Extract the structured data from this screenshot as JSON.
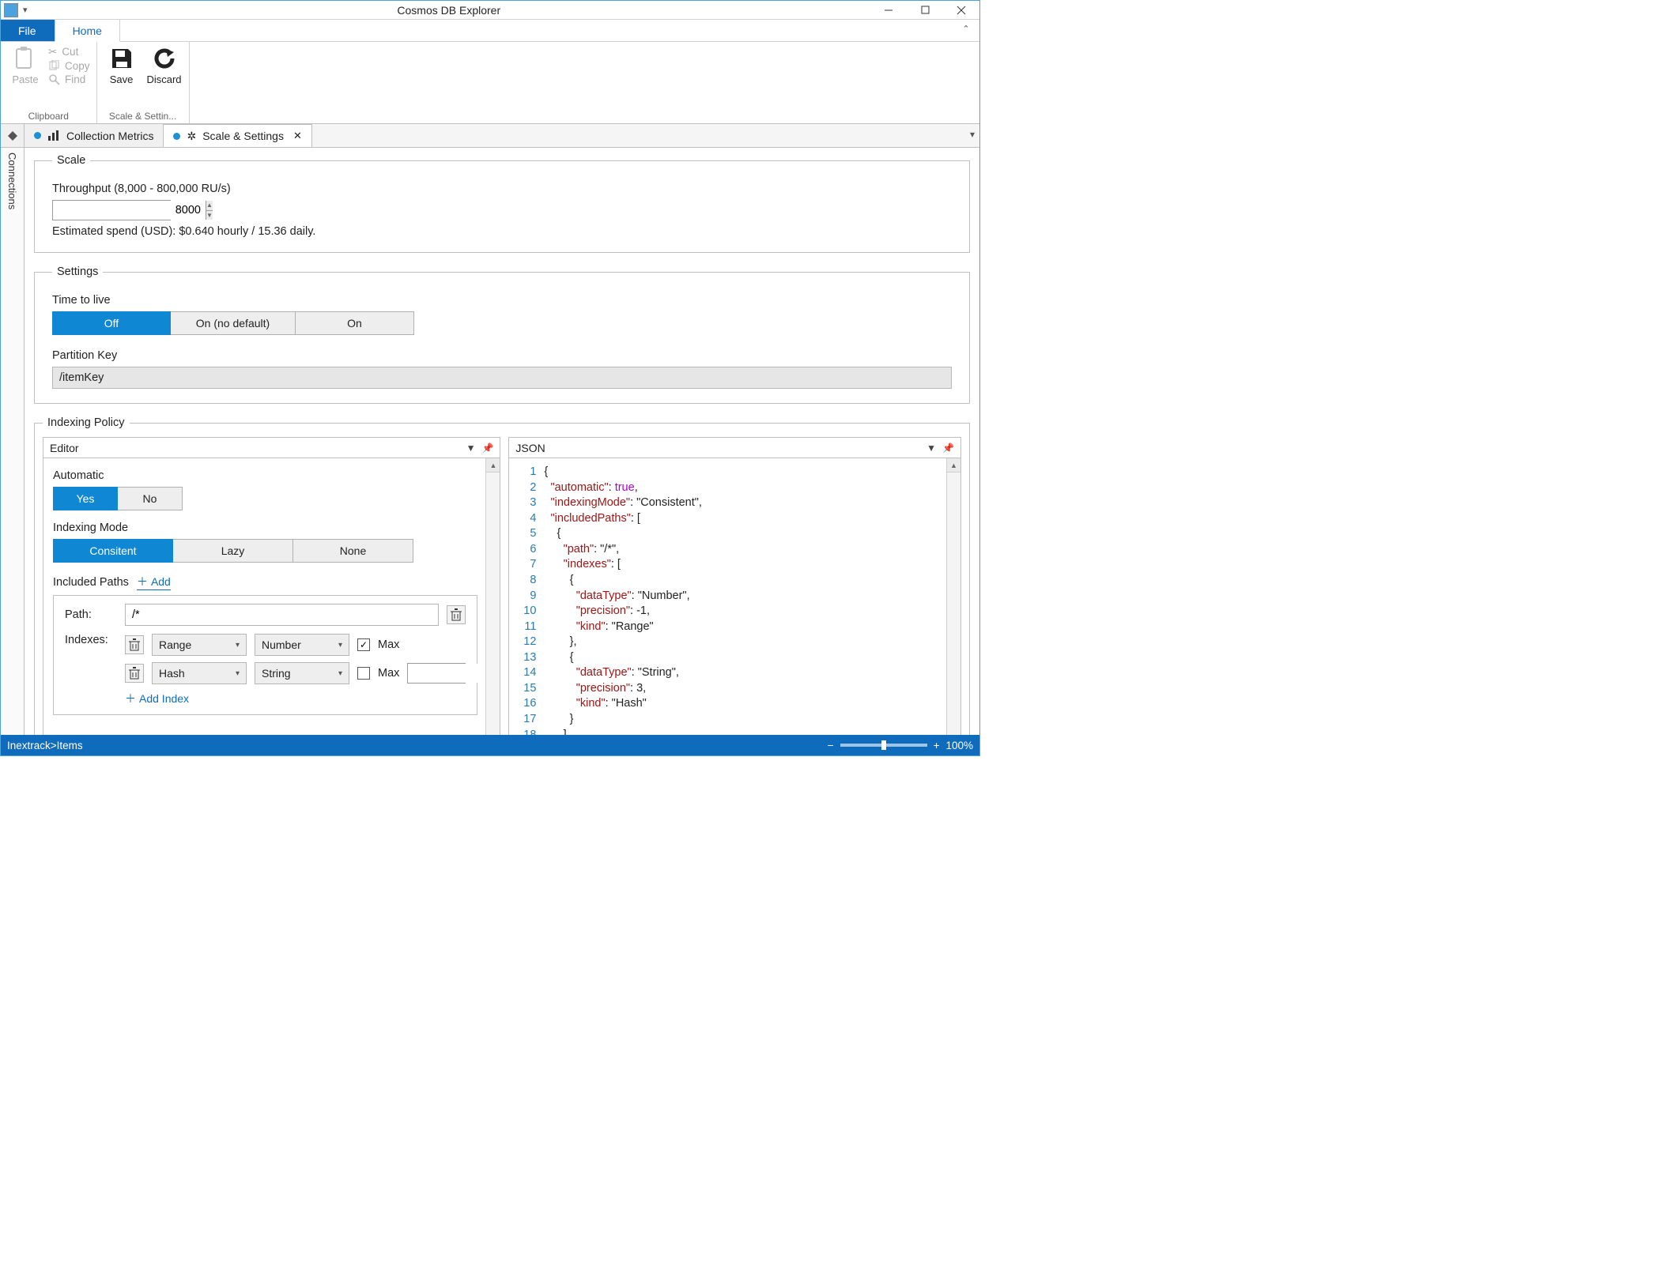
{
  "title": "Cosmos DB Explorer",
  "ribbonTabs": {
    "file": "File",
    "home": "Home"
  },
  "clipboard": {
    "paste": "Paste",
    "cut": "Cut",
    "copy": "Copy",
    "find": "Find",
    "groupLabel": "Clipboard"
  },
  "scaleGroup": {
    "save": "Save",
    "discard": "Discard",
    "groupLabel": "Scale & Settin..."
  },
  "sidebar": {
    "label": "Connections"
  },
  "docTabs": {
    "metrics": "Collection Metrics",
    "scaleSettings": "Scale & Settings"
  },
  "scale": {
    "legend": "Scale",
    "throughputLabel": "Throughput (8,000 - 800,000 RU/s)",
    "throughputValue": "8000",
    "estimate": "Estimated spend (USD): $0.640 hourly / 15.36 daily."
  },
  "settings": {
    "legend": "Settings",
    "ttlLabel": "Time to live",
    "ttlOptions": [
      "Off",
      "On (no default)",
      "On"
    ],
    "partitionKeyLabel": "Partition Key",
    "partitionKeyValue": "/itemKey"
  },
  "indexing": {
    "legend": "Indexing Policy",
    "editorTitle": "Editor",
    "jsonTitle": "JSON",
    "automaticLabel": "Automatic",
    "automaticOptions": [
      "Yes",
      "No"
    ],
    "indexingModeLabel": "Indexing Mode",
    "indexingModeOptions": [
      "Consitent",
      "Lazy",
      "None"
    ],
    "includedPathsLabel": "Included Paths",
    "addLabel": "Add",
    "pathRow": {
      "pathLabel": "Path:",
      "pathValue": "/*",
      "indexesLabel": "Indexes:",
      "rows": [
        {
          "kind": "Range",
          "dataType": "Number",
          "maxChecked": true
        },
        {
          "kind": "Hash",
          "dataType": "String",
          "maxChecked": false,
          "precision": "3"
        }
      ],
      "maxLabel": "Max",
      "addIndexLabel": "Add Index"
    }
  },
  "jsonLines": [
    "{",
    "  \"automatic\": true,",
    "  \"indexingMode\": \"Consistent\",",
    "  \"includedPaths\": [",
    "    {",
    "      \"path\": \"/*\",",
    "      \"indexes\": [",
    "        {",
    "          \"dataType\": \"Number\",",
    "          \"precision\": -1,",
    "          \"kind\": \"Range\"",
    "        },",
    "        {",
    "          \"dataType\": \"String\",",
    "          \"precision\": 3,",
    "          \"kind\": \"Hash\"",
    "        }",
    "      ]"
  ],
  "status": {
    "left": "Inextrack>Items",
    "zoom": "100%"
  }
}
